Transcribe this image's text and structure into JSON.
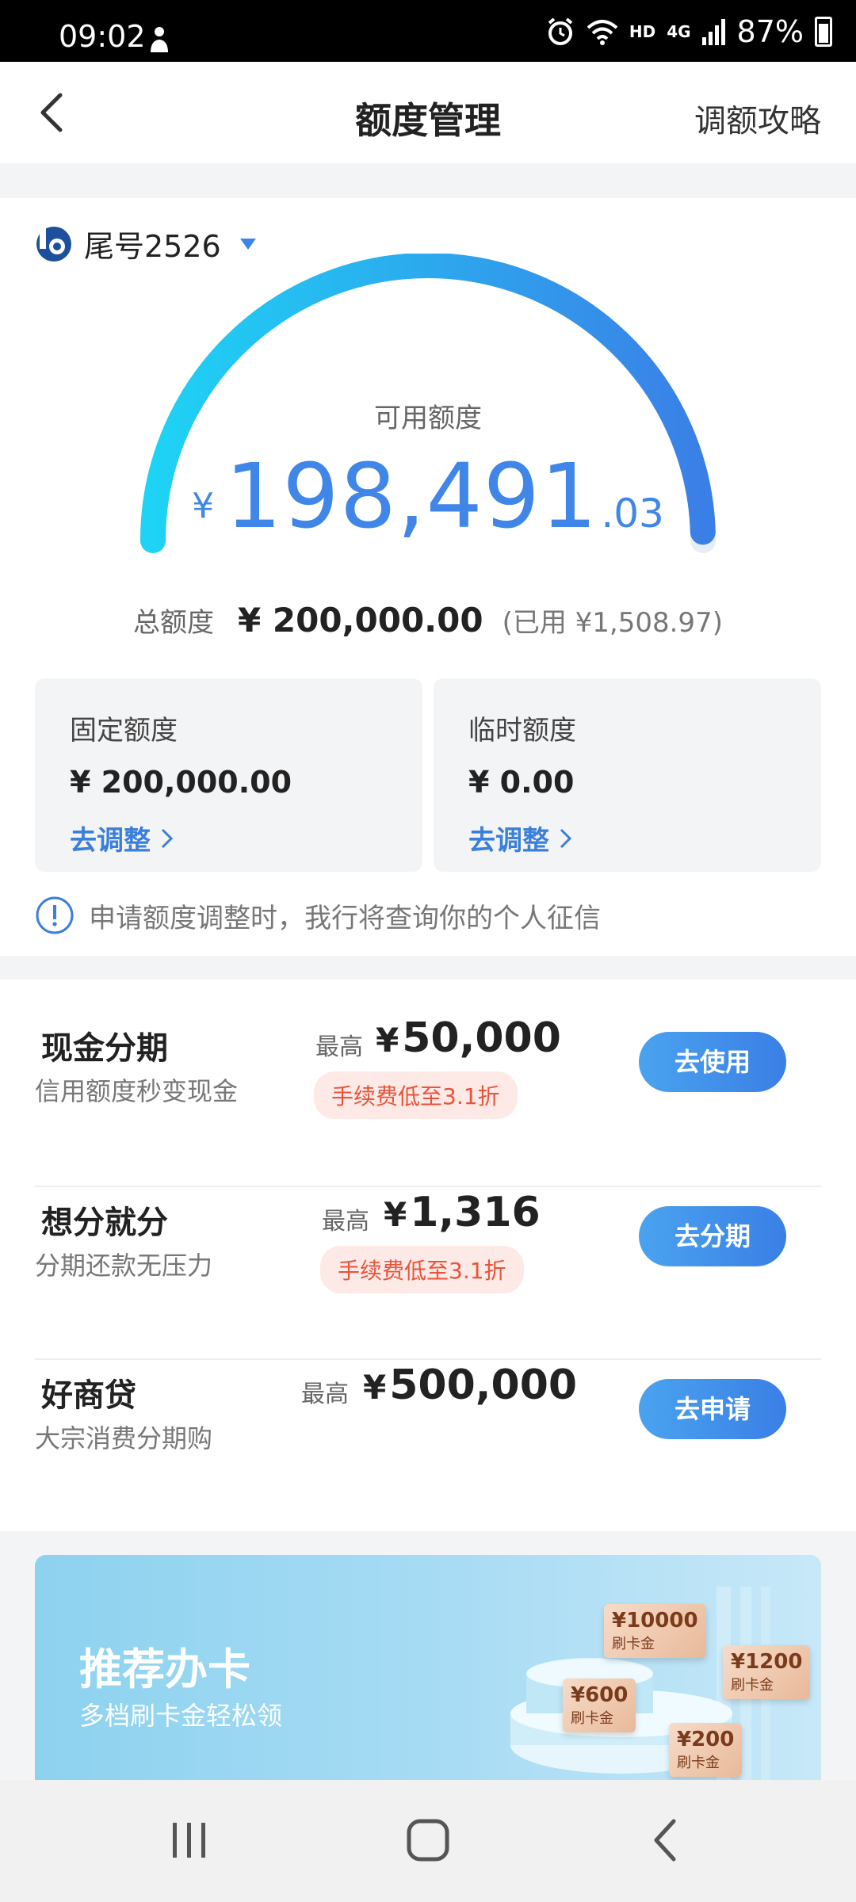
{
  "status_bar": {
    "time": "09:02",
    "network": "HD",
    "network_type": "4G",
    "battery": "87%"
  },
  "header": {
    "title": "额度管理",
    "right_link": "调额攻略"
  },
  "card": {
    "label": "尾号2526"
  },
  "available": {
    "label": "可用额度",
    "currency": "¥",
    "integer": "198,491",
    "decimal": ".03",
    "gauge_fill_fraction": 0.99
  },
  "total": {
    "label": "总额度",
    "amount": "¥ 200,000.00",
    "used": "(已用 ¥1,508.97)"
  },
  "fixed_quota": {
    "title": "固定额度",
    "value": "¥ 200,000.00",
    "link": "去调整"
  },
  "temp_quota": {
    "title": "临时额度",
    "value": "¥ 0.00",
    "link": "去调整"
  },
  "notice": "申请额度调整时，我行将查询你的个人征信",
  "products": [
    {
      "name": "现金分期",
      "desc": "信用额度秒变现金",
      "max_label": "最高",
      "currency": "¥",
      "amount": "50,000",
      "tag": "手续费低至3.1折",
      "button": "去使用"
    },
    {
      "name": "想分就分",
      "desc": "分期还款无压力",
      "max_label": "最高",
      "currency": "¥",
      "amount": "1,316",
      "tag": "手续费低至3.1折",
      "button": "去分期"
    },
    {
      "name": "好商贷",
      "desc": "大宗消费分期购",
      "max_label": "最高",
      "currency": "¥",
      "amount": "500,000",
      "button": "去申请"
    }
  ],
  "banner": {
    "title": "推荐办卡",
    "subtitle": "多档刷卡金轻松领",
    "chips": [
      {
        "value": "¥10000",
        "label": "刷卡金"
      },
      {
        "value": "¥1200",
        "label": "刷卡金"
      },
      {
        "value": "¥600",
        "label": "刷卡金"
      },
      {
        "value": "¥200",
        "label": "刷卡金"
      }
    ]
  },
  "colors": {
    "accent": "#3f86e8",
    "gauge_start": "#1ed3f5",
    "gauge_end": "#3a7fe6",
    "tag_text": "#e8533a",
    "tag_bg": "#fde9e6"
  }
}
